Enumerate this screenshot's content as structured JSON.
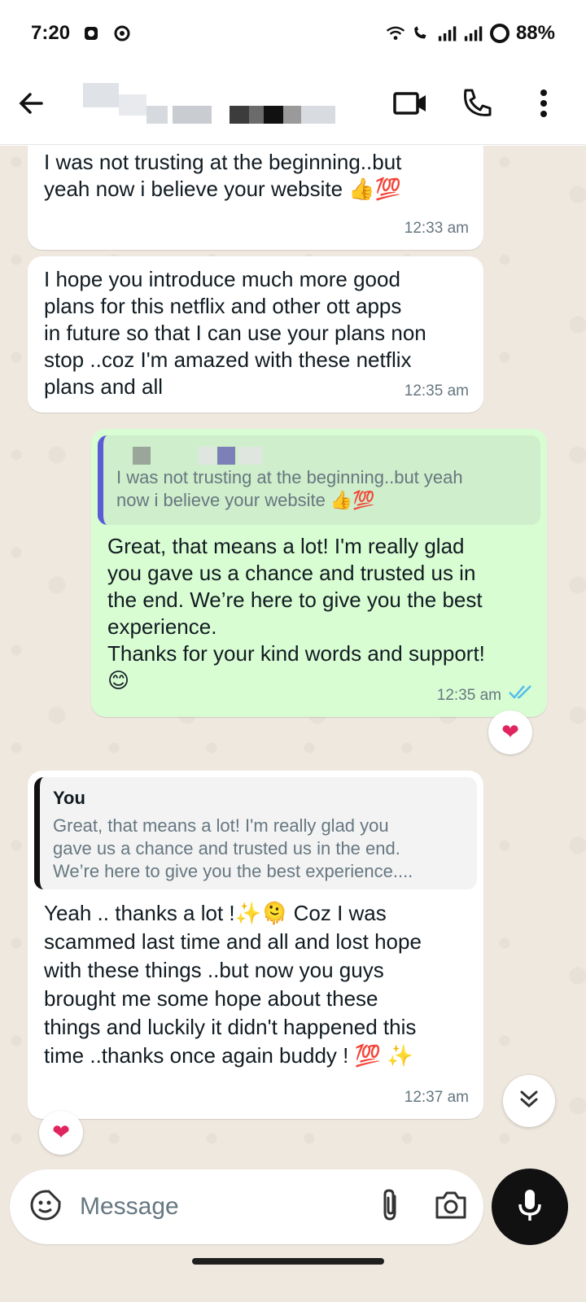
{
  "status_bar": {
    "time": "7:20",
    "battery": "88%"
  },
  "header": {
    "contact_name": ""
  },
  "messages": [
    {
      "type": "incoming",
      "text": "I was not trusting at the beginning..but\nyeah now i believe your website 👍💯",
      "time": "12:33 am"
    },
    {
      "type": "incoming",
      "text": "I hope you introduce much more good\nplans for this netflix and other ott apps\nin future so that I can use your plans non\nstop ..coz I'm amazed with these netflix\nplans and all",
      "time": "12:35 am"
    },
    {
      "type": "outgoing",
      "quote_text": "I was not trusting at the beginning..but yeah\nnow i believe your website 👍💯",
      "text": "Great, that means a lot! I'm really glad\nyou gave us a chance and trusted us in\nthe end. We’re here to give you the best\nexperience.\nThanks for your kind words and support!\n😊",
      "time": "12:35 am",
      "reaction": "❤"
    },
    {
      "type": "incoming",
      "quote_author": "You",
      "quote_text": "Great, that means a lot! I'm really glad you\ngave us a chance and trusted us in the end.\nWe’re here to give you the best experience....",
      "text": "Yeah .. thanks a lot !✨🫠 Coz I was\nscammed last time and all and lost hope\nwith these things ..but now you guys\nbrought me some hope about these\nthings and luckily it didn't happened this\ntime ..thanks once again buddy ! 💯 ✨",
      "time": "12:37 am",
      "reaction": "❤"
    }
  ],
  "input": {
    "placeholder": "Message"
  },
  "icons": {
    "back": "arrow-left-icon",
    "video": "video-call-icon",
    "call": "phone-icon",
    "menu": "more-vert-icon",
    "sticker": "sticker-icon",
    "attach": "paperclip-icon",
    "camera": "camera-icon",
    "mic": "microphone-icon",
    "scroll": "double-chevron-down-icon",
    "read": "double-check-icon"
  },
  "colors": {
    "outgoing_bubble": "#d9fdd3",
    "incoming_bubble": "#ffffff",
    "chat_background": "#efe8df",
    "read_ticks": "#53bdeb",
    "outgoing_quote_bar": "#5b5bd6",
    "incoming_quote_bar": "#111111"
  }
}
